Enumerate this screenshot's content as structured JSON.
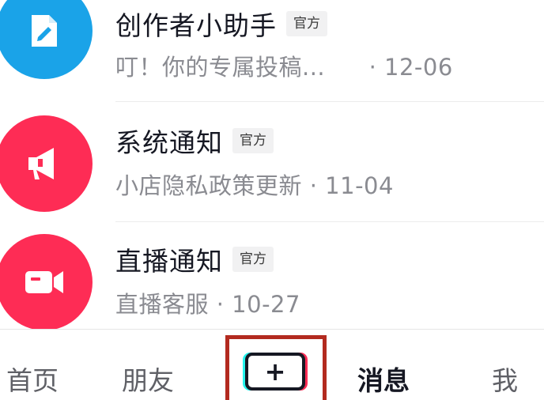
{
  "messages": [
    {
      "title": "创作者小助手",
      "badge": "官方",
      "preview": "叮！你的专属投稿...",
      "date": "· 12-06",
      "icon": "edit-document-icon",
      "color": "#1aa3e8"
    },
    {
      "title": "系统通知",
      "badge": "官方",
      "preview": "小店隐私政策更新",
      "date": "· 11-04",
      "icon": "megaphone-icon",
      "color": "#fe2c55"
    },
    {
      "title": "直播通知",
      "badge": "官方",
      "preview": "直播客服",
      "date": "· 10-27",
      "icon": "video-camera-icon",
      "color": "#fe2c55"
    }
  ],
  "tabbar": {
    "home": "首页",
    "friends": "朋友",
    "create": "+",
    "messages": "消息",
    "me": "我",
    "active_tab": "消息"
  },
  "colors": {
    "highlight_border": "#b32a1f",
    "text_primary": "#161823",
    "text_secondary": "#8a8b91"
  }
}
